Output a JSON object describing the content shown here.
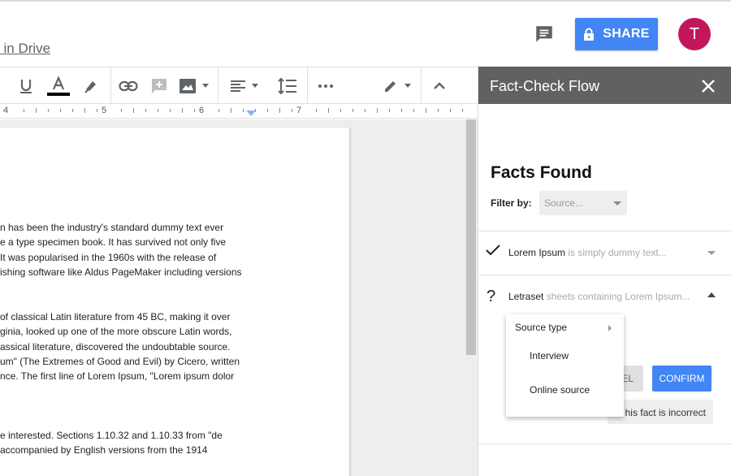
{
  "header": {
    "drive_link": "l in Drive",
    "share_label": "SHARE",
    "avatar_initial": "T"
  },
  "ruler": {
    "labels": [
      "4",
      "5",
      "6",
      "7"
    ]
  },
  "document": {
    "paragraphs": [
      [
        "n has been the industry's standard dummy text ever",
        "e a type specimen book. It has survived not only five",
        "It was popularised in the 1960s with the release of",
        "ishing software like Aldus PageMaker including versions"
      ],
      [
        "of classical Latin literature from 45 BC, making it over",
        "ginia, looked up one of the more obscure Latin words,",
        "assical literature, discovered the undoubtable source.",
        "um\" (The Extremes of Good and Evil) by Cicero, written",
        "nce. The first line of Lorem Ipsum, \"Lorem ipsum dolor"
      ],
      [
        "e interested. Sections 1.10.32 and 1.10.33 from \"de",
        "accompanied by English versions from the 1914"
      ]
    ]
  },
  "panel": {
    "title": "Fact-Check Flow",
    "facts_title": "Facts Found",
    "filter_label": "Filter by:",
    "filter_placeholder": "Source...",
    "facts": [
      {
        "mark": "✓",
        "name": "Lorem Ipsum",
        "snippet": " is simply dummy text..."
      },
      {
        "mark": "?",
        "name": "Letraset",
        "snippet": " sheets containing Lorem Ipsum..."
      }
    ],
    "cancel_label": "EL",
    "confirm_label": "CONFIRM",
    "incorrect_label": "his fact is incorrect"
  },
  "menu": {
    "source_type": "Source type",
    "options": [
      "Interview",
      "Online source"
    ]
  },
  "colors": {
    "accent": "#4285f4",
    "panel_header": "#616161",
    "avatar": "#c2185b"
  }
}
